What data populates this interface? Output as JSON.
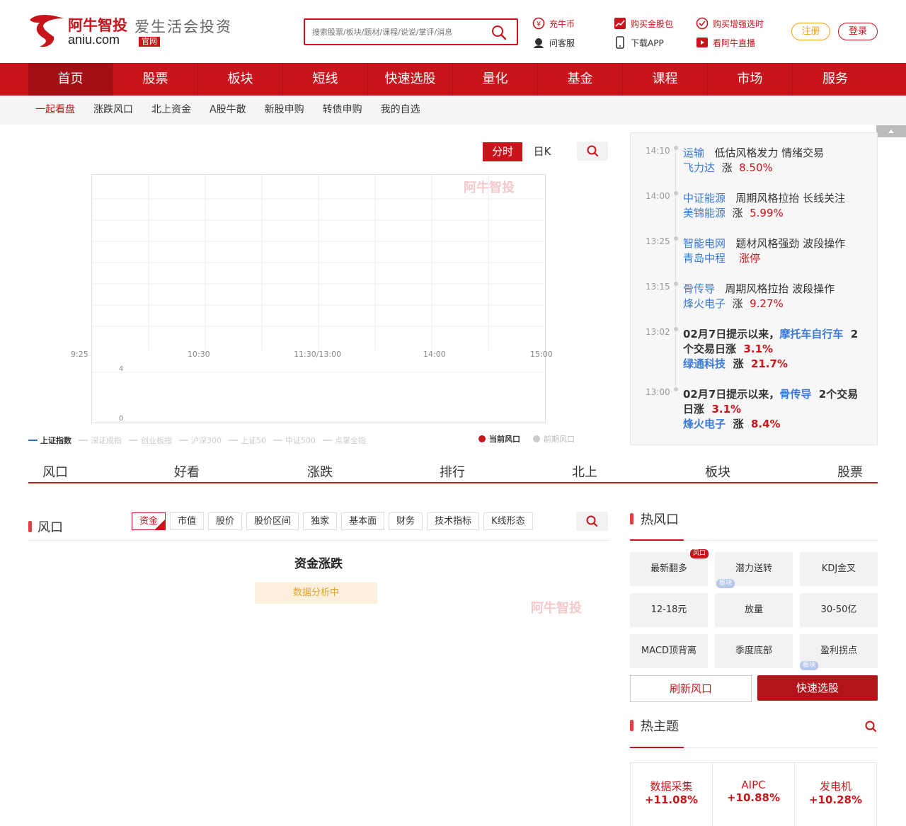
{
  "header": {
    "brand": "阿牛智投",
    "domain": "aniu.com",
    "official": "官网",
    "slogan": "爱生活会投资",
    "search_placeholder": "搜索股票/板块/题材/课程/说说/掌评/消息",
    "links": {
      "coin": "充牛币",
      "service": "问客服",
      "buy_gold": "购买金股包",
      "download": "下载APP",
      "buy_enhanced": "购买增强选时",
      "live": "看阿牛直播"
    },
    "register": "注册",
    "login": "登录"
  },
  "nav": [
    "首页",
    "股票",
    "板块",
    "短线",
    "快速选股",
    "量化",
    "基金",
    "课程",
    "市场",
    "服务"
  ],
  "subnav": [
    "一起看盘",
    "涨跌风口",
    "北上资金",
    "A股牛散",
    "新股申购",
    "转债申购",
    "我的自选"
  ],
  "chart": {
    "tabs": [
      "分时",
      "日K"
    ],
    "x_labels": [
      "9:25",
      "10:30",
      "11:30/13:00",
      "14:00",
      "15:00"
    ],
    "vol_labels": [
      "4",
      "0"
    ],
    "legend": [
      "上证指数",
      "深证成指",
      "创业板指",
      "沪深300",
      "上证50",
      "中证500",
      "点掌全指"
    ],
    "fengkou_current": "当前风口",
    "fengkou_prev": "前期风口",
    "watermark": "阿牛智投"
  },
  "feed": [
    {
      "time": "14:10",
      "topic": "运输",
      "desc": "低估风格发力 情绪交易",
      "stock": "飞力达",
      "word": "涨",
      "value": "8.50%"
    },
    {
      "time": "14:00",
      "topic": "中证能源",
      "desc": "周期风格拉抬 长线关注",
      "stock": "美锦能源",
      "word": "涨",
      "value": "5.99%"
    },
    {
      "time": "13:25",
      "topic": "智能电网",
      "desc": "题材风格强劲 波段操作",
      "stock": "青岛中程",
      "word": "",
      "value": "涨停"
    },
    {
      "time": "13:15",
      "topic": "骨传导",
      "desc": "周期风格拉抬 波段操作",
      "stock": "烽火电子",
      "word": "涨",
      "value": "9.27%"
    },
    {
      "time": "13:02",
      "pre": "02月7日提示以来，",
      "topic": "摩托车自行车",
      "mid": "2个交易日涨",
      "pct": "3.1%",
      "stock": "绿通科技",
      "word": "涨",
      "value": "21.7%"
    },
    {
      "time": "13:00",
      "pre": "02月7日提示以来，",
      "topic": "骨传导",
      "mid": "2个交易日涨",
      "pct": "3.1%",
      "stock": "烽火电子",
      "word": "涨",
      "value": "8.4%"
    }
  ],
  "section_tabs": [
    "风口",
    "好看",
    "涨跌",
    "排行",
    "北上",
    "板块",
    "股票"
  ],
  "fengkou": {
    "title": "风口",
    "filters": [
      "资金",
      "市值",
      "股价",
      "股价区间",
      "独家",
      "基本面",
      "财务",
      "技术指标",
      "K线形态"
    ],
    "heading": "资金涨跌",
    "status": "数据分析中"
  },
  "hot_fengkou": {
    "title": "热风口",
    "cells": [
      "最新翻多",
      "潜力送转",
      "KDJ金叉",
      "12-18元",
      "放量",
      "30-50亿",
      "MACD顶背离",
      "季度底部",
      "盈利拐点"
    ],
    "badge_fk": "风口",
    "badge_bk": "板块",
    "refresh": "刷新风口",
    "quick": "快速选股"
  },
  "hot_topics": {
    "title": "热主题",
    "items": [
      {
        "name": "数据采集",
        "value": "+11.08%"
      },
      {
        "name": "AIPC",
        "value": "+10.88%"
      },
      {
        "name": "发电机",
        "value": "+10.28%"
      }
    ]
  },
  "colors": {
    "brand_red": "#c8141b",
    "link_blue": "#3a7ad9",
    "orange": "#f0a020"
  }
}
